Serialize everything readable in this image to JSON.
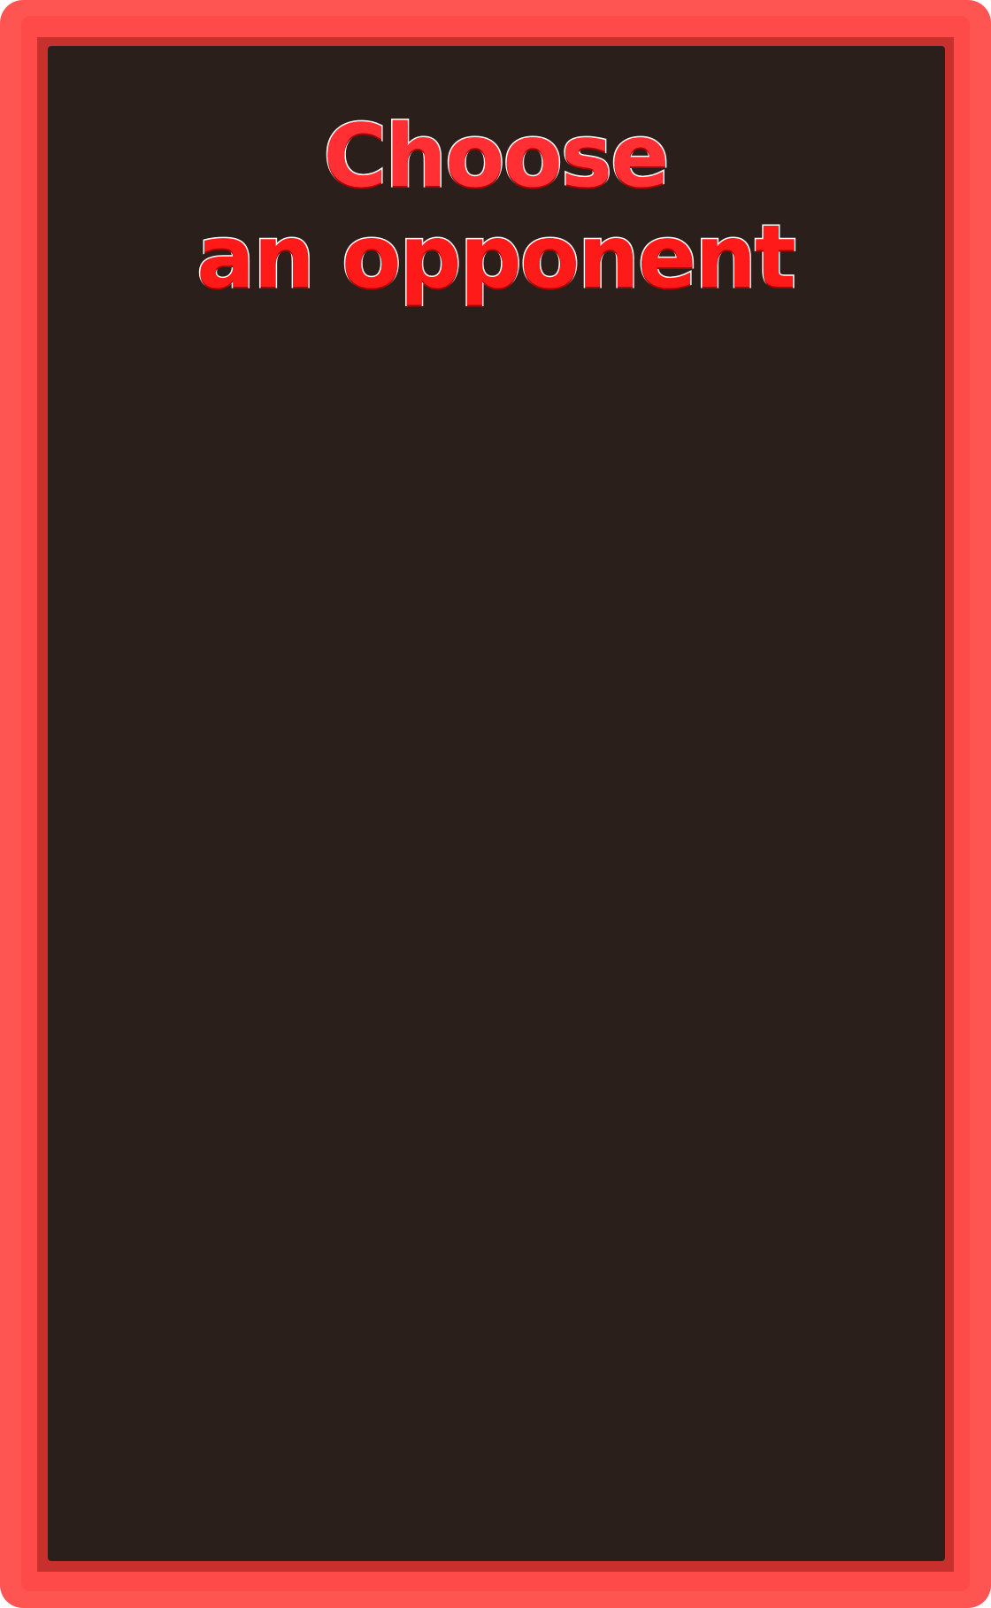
{
  "screen": {
    "title_line_1": "Choose",
    "title_line_2": "an opponent"
  },
  "colors": {
    "frame": "#ff5552",
    "frame_inner": "#ff4a4a",
    "frame_edge": "#c8302e",
    "panel_background": "#2a1f1b",
    "title_fill": "#ff1a1a",
    "title_outline": "#ffffff"
  }
}
